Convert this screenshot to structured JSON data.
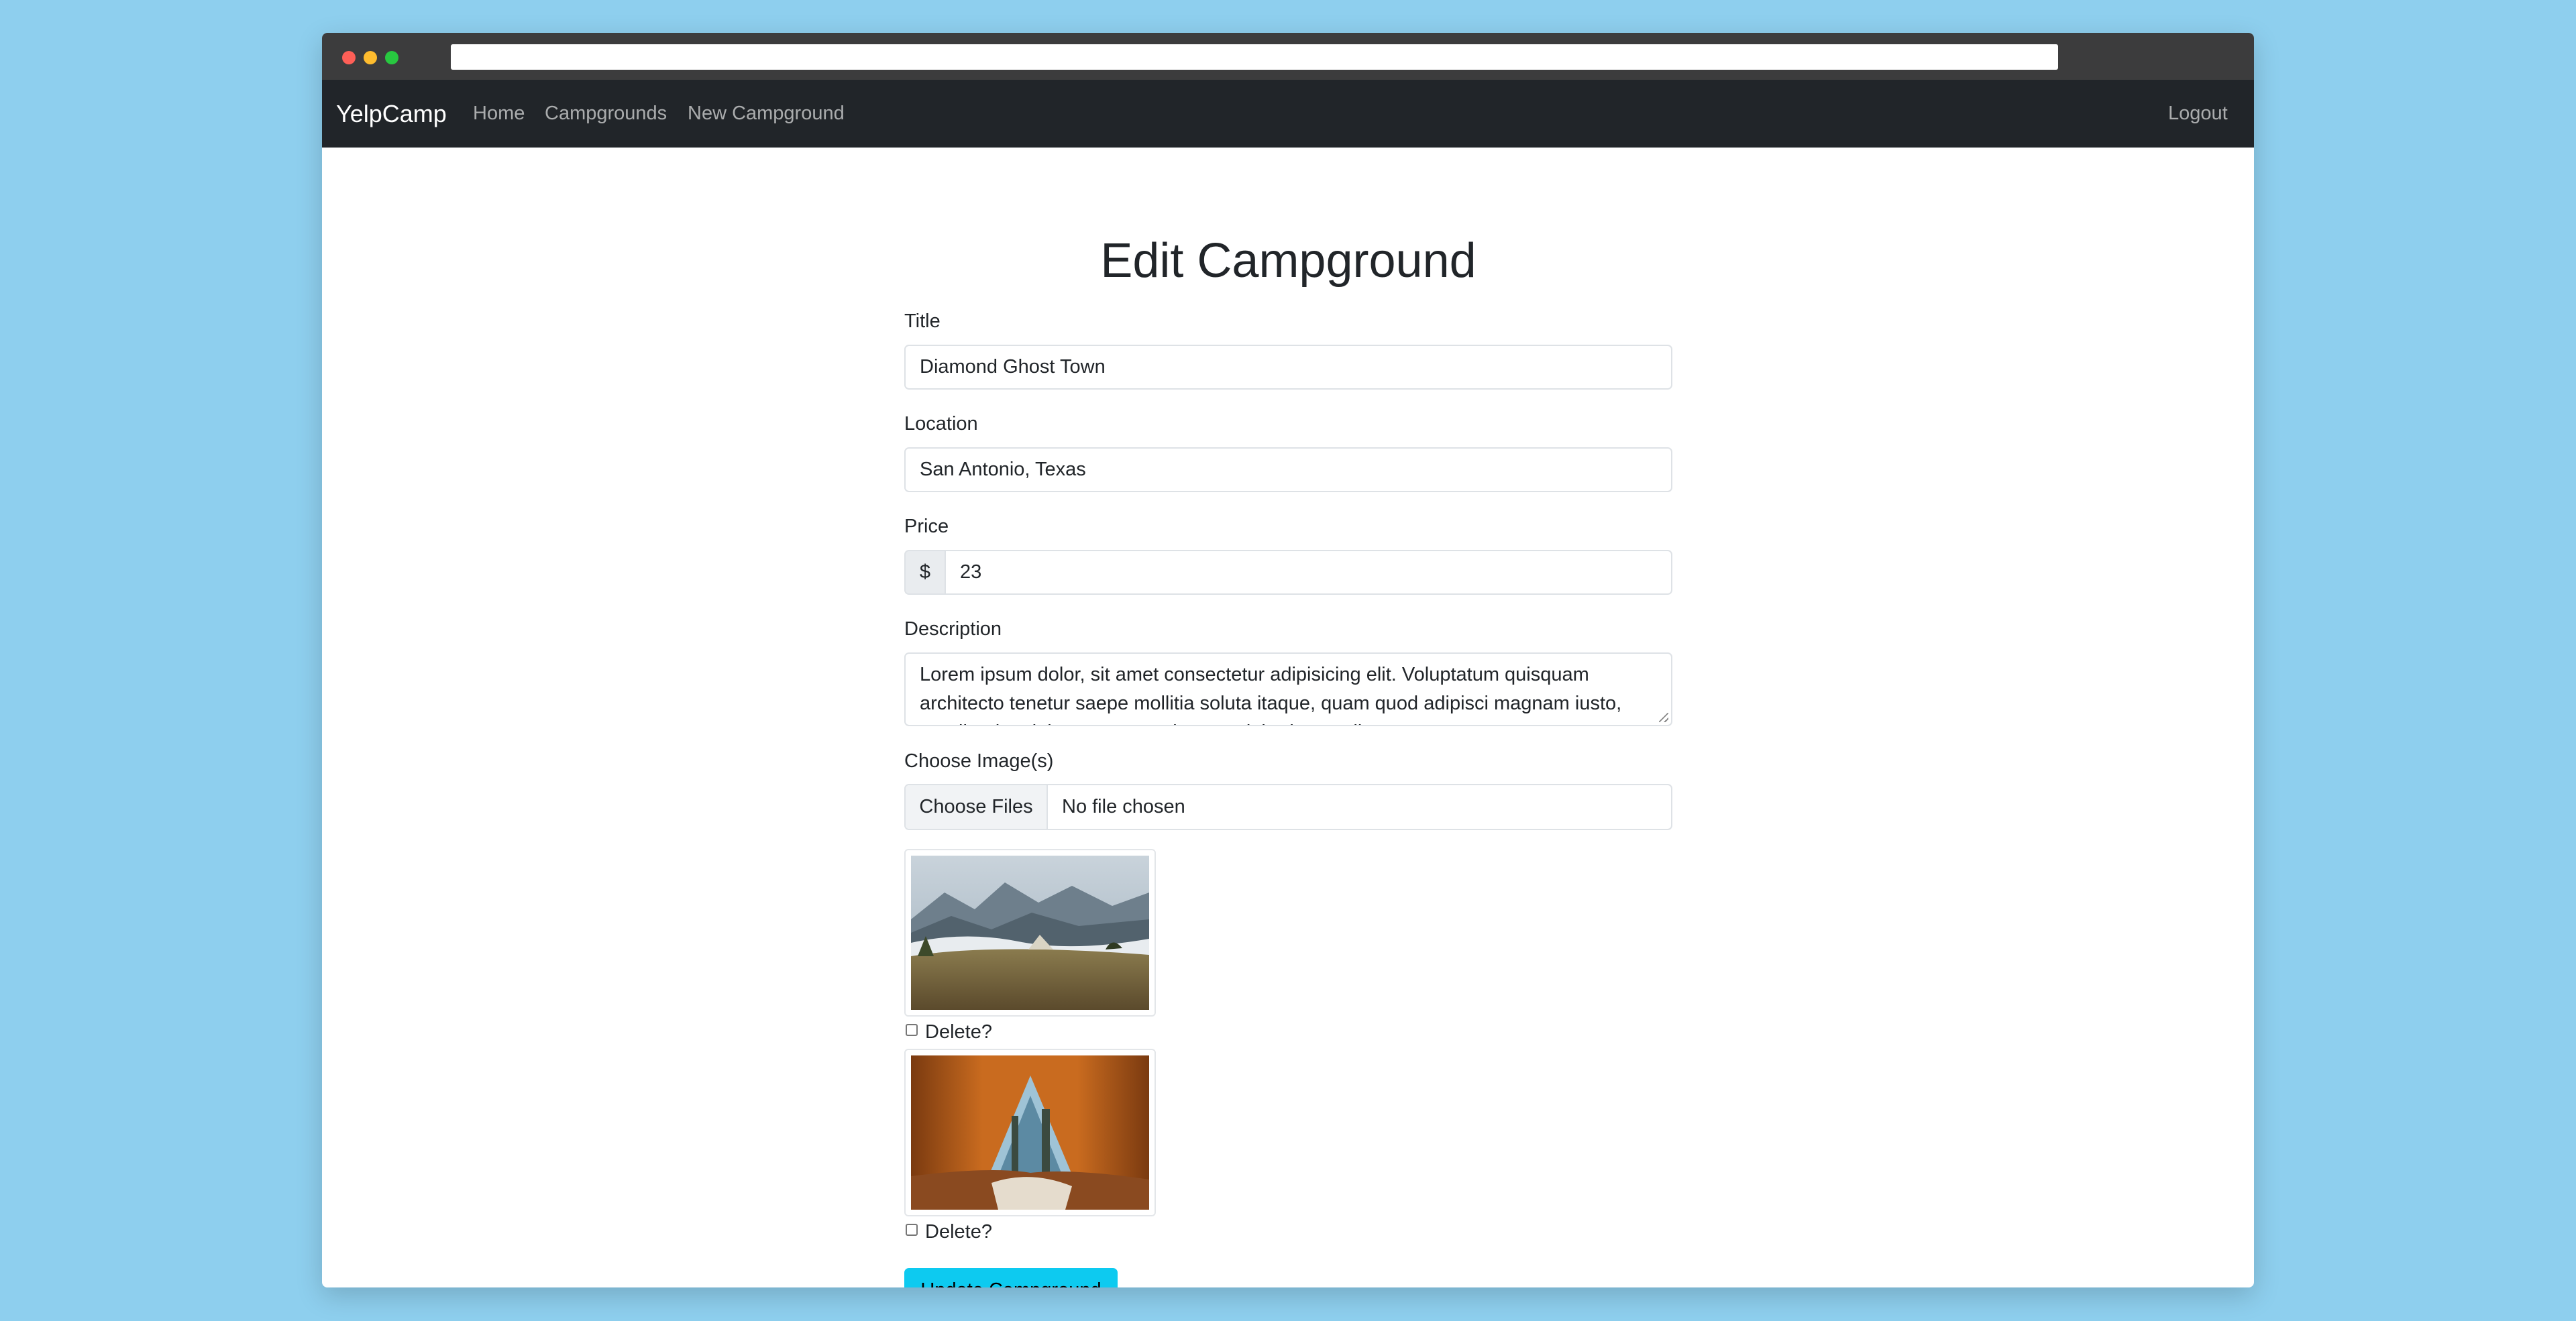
{
  "browser": {
    "url": ""
  },
  "navbar": {
    "brand": "YelpCamp",
    "links": [
      "Home",
      "Campgrounds",
      "New Campground"
    ],
    "logout": "Logout"
  },
  "form": {
    "heading": "Edit Campground",
    "title_label": "Title",
    "title_value": "Diamond Ghost Town",
    "location_label": "Location",
    "location_value": "San Antonio, Texas",
    "price_label": "Price",
    "price_prefix": "$",
    "price_value": "23",
    "description_label": "Description",
    "description_value": "Lorem ipsum dolor, sit amet consectetur adipisicing elit. Voluptatum quisquam architecto tenetur saepe mollitia soluta itaque, quam quod adipisci magnam iusto, repellendus delectus amet voluptates laboriosam dicta.",
    "images_label": "Choose Image(s)",
    "file_button": "Choose Files",
    "file_status": "No file chosen",
    "existing_images": [
      {
        "delete_label": "Delete?",
        "checked": false
      },
      {
        "delete_label": "Delete?",
        "checked": false
      }
    ],
    "submit_label": "Update Campground"
  },
  "colors": {
    "page_bg": "#8ecfee",
    "navbar_bg": "#212529",
    "submit_bg": "#0dcaf0"
  }
}
